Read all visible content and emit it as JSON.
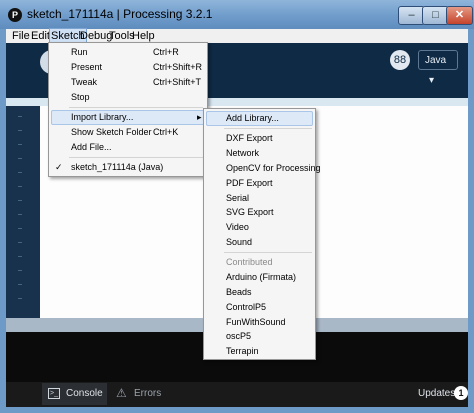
{
  "window": {
    "title": "sketch_171114a | Processing 3.2.1",
    "app_icon_glyph": "P",
    "min_glyph": "–",
    "max_glyph": "□",
    "close_glyph": "✕"
  },
  "menubar": {
    "items": [
      "File",
      "Edit",
      "Sketch",
      "Debug",
      "Tools",
      "Help"
    ],
    "active": "Sketch"
  },
  "toolbar": {
    "mode_glyph": "88",
    "mode_select": "Java",
    "select_arrow": "▾"
  },
  "sketch_menu": {
    "items": [
      {
        "label": "Run",
        "shortcut": "Ctrl+R"
      },
      {
        "label": "Present",
        "shortcut": "Ctrl+Shift+R"
      },
      {
        "label": "Tweak",
        "shortcut": "Ctrl+Shift+T"
      },
      {
        "label": "Stop",
        "shortcut": ""
      },
      {
        "label": "Import Library...",
        "shortcut": "",
        "submenu_arrow": "▸"
      },
      {
        "label": "Show Sketch Folder",
        "shortcut": "Ctrl+K"
      },
      {
        "label": "Add File...",
        "shortcut": ""
      },
      {
        "label": "sketch_171114a (Java)",
        "shortcut": "",
        "check": "✓"
      }
    ]
  },
  "import_library_submenu": {
    "add_library": "Add Library...",
    "core": [
      "DXF Export",
      "Network",
      "OpenCV for Processing",
      "PDF Export",
      "Serial",
      "SVG Export",
      "Video",
      "Sound"
    ],
    "contributed_header": "Contributed",
    "contributed": [
      "Arduino (Firmata)",
      "Beads",
      "ControlP5",
      "FunWithSound",
      "oscP5",
      "Terrapin"
    ]
  },
  "footer": {
    "console_tab": "Console",
    "errors_tab": "Errors",
    "updates_label": "Updates",
    "updates_count": "1",
    "console_icon_glyph": ">_",
    "warning_glyph": "⚠"
  },
  "colors": {
    "toolbar_bg": "#0e2a45",
    "menu_highlight": "#dde9f7",
    "editor_bg": "#fdfdfd"
  }
}
